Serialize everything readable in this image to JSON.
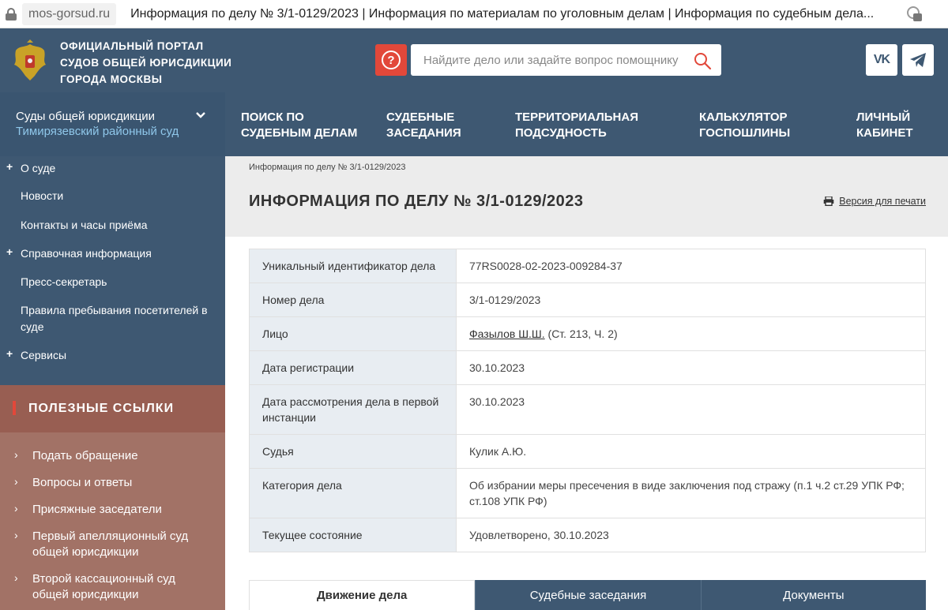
{
  "browser": {
    "domain": "mos-gorsud.ru",
    "title": "Информация по делу № 3/1-0129/2023 | Информация по материалам по уголовным делам | Информация по судебным дела..."
  },
  "header": {
    "portal_title_lines": [
      "Официальный портал",
      "судов общей юрисдикции",
      "города Москвы"
    ],
    "help_glyph": "?",
    "search_placeholder": "Найдите дело или задайте вопрос помощнику",
    "vk_label": "VK",
    "brand_color": "#3e5872",
    "accent_color": "#e2483a"
  },
  "nav": {
    "court_group": "Суды общей юрисдикции",
    "court_name": "Тимирязевский районный суд",
    "items": [
      [
        "Поиск по",
        "судебным делам"
      ],
      [
        "Судебные",
        "заседания"
      ],
      [
        "Территориальная",
        "подсудность"
      ],
      [
        "Калькулятор",
        "госпошлины"
      ],
      [
        "Личный",
        "кабинет"
      ]
    ]
  },
  "sidebar": {
    "items": [
      {
        "label": "О суде",
        "expandable": true
      },
      {
        "label": "Новости",
        "expandable": false
      },
      {
        "label": "Контакты и часы приёма",
        "expandable": false
      },
      {
        "label": "Справочная информация",
        "expandable": true
      },
      {
        "label": "Пресс-секретарь",
        "expandable": false
      },
      {
        "label": "Правила пребывания посетителей в суде",
        "expandable": false
      },
      {
        "label": "Сервисы",
        "expandable": true
      }
    ]
  },
  "useful_links": {
    "title": "Полезные ссылки",
    "items": [
      "Подать обращение",
      "Вопросы и ответы",
      "Присяжные заседатели",
      "Первый апелляционный суд общей юрисдикции",
      "Второй кассационный суд общей юрисдикции"
    ]
  },
  "main": {
    "breadcrumb": "Информация по делу № 3/1-0129/2023",
    "title": "Информация по делу № 3/1-0129/2023",
    "print_label": "Версия для печати",
    "rows": [
      {
        "key": "Уникальный идентификатор дела",
        "value": "77RS0028-02-2023-009284-37"
      },
      {
        "key": "Номер дела",
        "value": "3/1-0129/2023"
      },
      {
        "key": "Лицо",
        "link": "Фазылов Ш.Ш.",
        "value": " (Ст. 213, Ч. 2)"
      },
      {
        "key": "Дата регистрации",
        "value": "30.10.2023"
      },
      {
        "key": "Дата рассмотрения дела в первой инстанции",
        "value": "30.10.2023"
      },
      {
        "key": "Судья",
        "value": "Кулик А.Ю."
      },
      {
        "key": "Категория дела",
        "value": "Об избрании меры пресечения в виде заключения под стражу (п.1 ч.2 ст.29 УПК РФ; ст.108 УПК РФ)"
      },
      {
        "key": "Текущее состояние",
        "value": "Удовлетворено, 30.10.2023"
      }
    ],
    "tabs": [
      "Движение дела",
      "Судебные заседания",
      "Документы"
    ],
    "active_tab": 0
  }
}
